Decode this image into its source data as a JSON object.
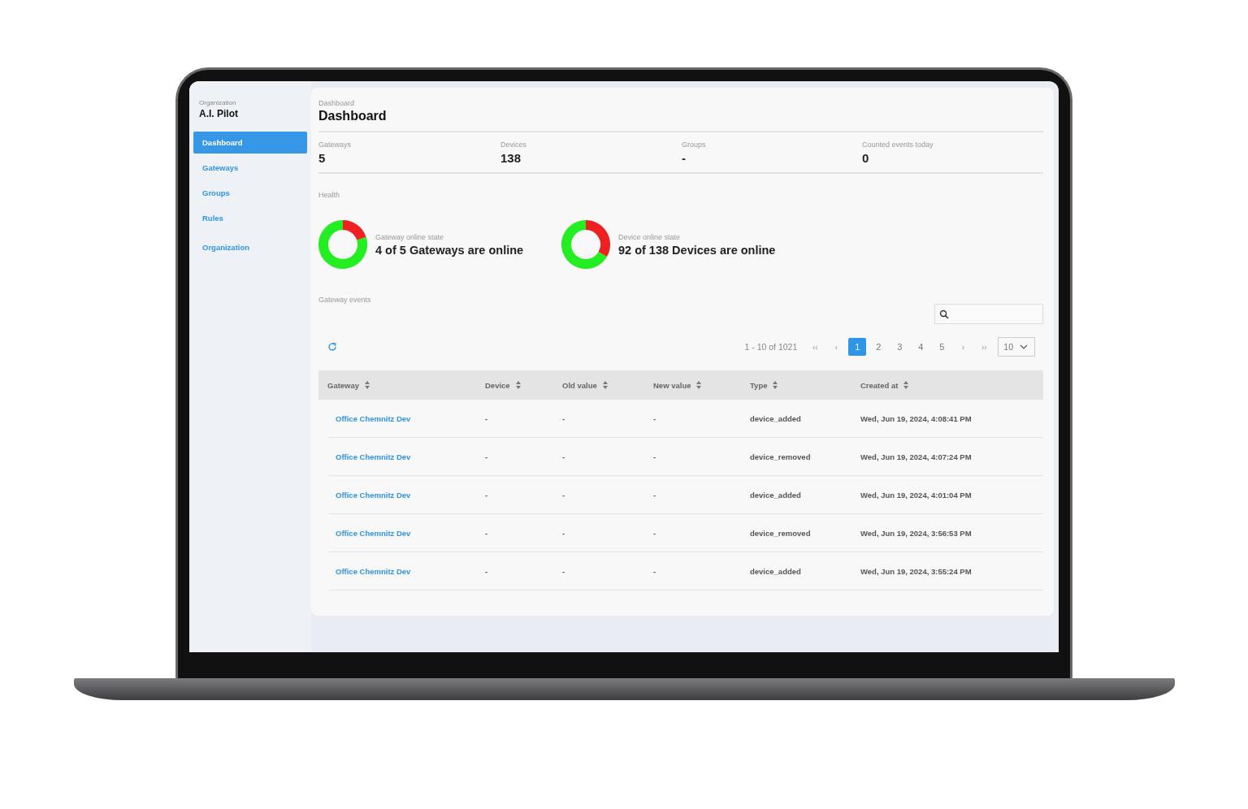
{
  "sidebar": {
    "org_label": "Organization",
    "org_name": "A.I. Pilot",
    "items": [
      {
        "label": "Dashboard",
        "selected": true
      },
      {
        "label": "Gateways",
        "selected": false
      },
      {
        "label": "Groups",
        "selected": false
      },
      {
        "label": "Rules",
        "selected": false
      },
      {
        "label": "Organization",
        "selected": false
      }
    ]
  },
  "header": {
    "breadcrumb": "Dashboard",
    "title": "Dashboard"
  },
  "stats": [
    {
      "label": "Gateways",
      "value": "5"
    },
    {
      "label": "Devices",
      "value": "138"
    },
    {
      "label": "Groups",
      "value": "-"
    },
    {
      "label": "Counted events today",
      "value": "0"
    }
  ],
  "health": {
    "title": "Health",
    "items": [
      {
        "label": "Gateway online state",
        "text": "4 of 5 Gateways are online"
      },
      {
        "label": "Device online state",
        "text": "92 of 138 Devices are online"
      }
    ]
  },
  "events": {
    "title": "Gateway events",
    "range": "1 - 10 of 1021",
    "first": "‹‹",
    "prev": "‹",
    "next": "›",
    "last": "››",
    "pages": [
      {
        "label": "1",
        "selected": true
      },
      {
        "label": "2",
        "selected": false
      },
      {
        "label": "3",
        "selected": false
      },
      {
        "label": "4",
        "selected": false
      },
      {
        "label": "5",
        "selected": false
      }
    ],
    "page_size": "10",
    "columns": [
      "Gateway",
      "Device",
      "Old value",
      "New value",
      "Type",
      "Created at"
    ],
    "rows": [
      [
        "Office Chemnitz Dev",
        "-",
        "-",
        "-",
        "device_added",
        "Wed, Jun 19, 2024, 4:08:41 PM"
      ],
      [
        "Office Chemnitz Dev",
        "-",
        "-",
        "-",
        "device_removed",
        "Wed, Jun 19, 2024, 4:07:24 PM"
      ],
      [
        "Office Chemnitz Dev",
        "-",
        "-",
        "-",
        "device_added",
        "Wed, Jun 19, 2024, 4:01:04 PM"
      ],
      [
        "Office Chemnitz Dev",
        "-",
        "-",
        "-",
        "device_removed",
        "Wed, Jun 19, 2024, 3:56:53 PM"
      ],
      [
        "Office Chemnitz Dev",
        "-",
        "-",
        "-",
        "device_added",
        "Wed, Jun 19, 2024, 3:55:24 PM"
      ]
    ]
  }
}
